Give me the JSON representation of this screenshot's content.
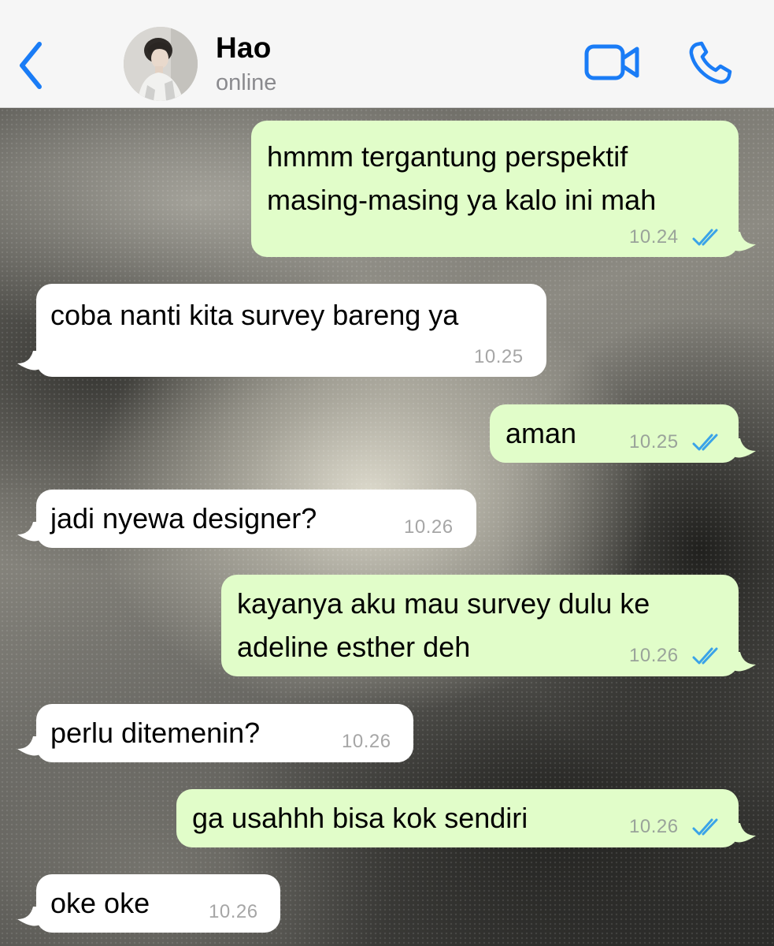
{
  "header": {
    "contact_name": "Hao",
    "status": "online",
    "icons": {
      "back": "chevron-left-icon",
      "video": "video-camera-icon",
      "call": "phone-icon"
    },
    "accent_color": "#1a7cf6"
  },
  "messages": [
    {
      "direction": "outgoing",
      "lines": [
        "hmmm tergantung perspektif",
        "masing-masing ya kalo ini mah"
      ],
      "time": "10.24",
      "read": true
    },
    {
      "direction": "incoming",
      "lines": [
        "coba nanti kita survey bareng ya"
      ],
      "time": "10.25"
    },
    {
      "direction": "outgoing",
      "lines": [
        "aman"
      ],
      "time": "10.25",
      "read": true
    },
    {
      "direction": "incoming",
      "lines": [
        "jadi nyewa designer?"
      ],
      "time": "10.26"
    },
    {
      "direction": "outgoing",
      "lines": [
        "kayanya aku mau survey dulu ke",
        "adeline esther deh"
      ],
      "time": "10.26",
      "read": true
    },
    {
      "direction": "incoming",
      "lines": [
        "perlu ditemenin?"
      ],
      "time": "10.26"
    },
    {
      "direction": "outgoing",
      "lines": [
        "ga usahhh bisa kok sendiri"
      ],
      "time": "10.26",
      "read": true
    },
    {
      "direction": "incoming",
      "lines": [
        "oke oke"
      ],
      "time": "10.26"
    }
  ],
  "colors": {
    "outgoing_bubble": "#e1fdc9",
    "incoming_bubble": "#ffffff",
    "read_ticks": "#3aa3e8"
  }
}
